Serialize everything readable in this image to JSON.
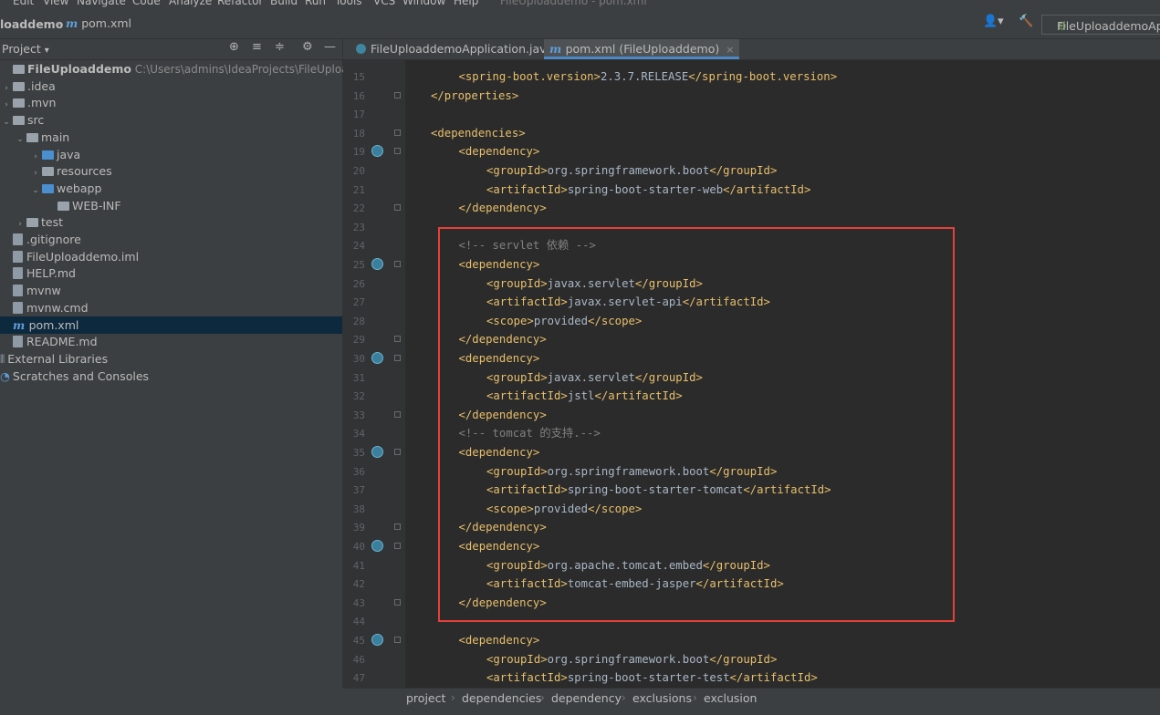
{
  "menubar": {
    "items": [
      "Edit",
      "View",
      "Navigate",
      "Code",
      "Analyze",
      "Refactor",
      "Build",
      "Run",
      "Tools",
      "VCS",
      "Window",
      "Help"
    ],
    "window_title": "FileUploaddemo - pom.xml"
  },
  "navbar": {
    "project": "loaddemo",
    "file_icon": "m",
    "file": "pom.xml",
    "run_config": "FileUploaddemoAp"
  },
  "sidebar": {
    "title": "Project",
    "title_arrow": "▾",
    "tools": [
      "⊕",
      "≡",
      "≑",
      "⚙",
      "—"
    ],
    "tree": [
      {
        "label": "FileUploaddemo",
        "path": "C:\\Users\\admins\\IdeaProjects\\FileUploaddemo",
        "indent": 0,
        "arrow": "",
        "icon": "folder",
        "bold": true
      },
      {
        "label": ".idea",
        "indent": 0,
        "arrow": "›",
        "icon": "folder"
      },
      {
        "label": ".mvn",
        "indent": 0,
        "arrow": "›",
        "icon": "folder"
      },
      {
        "label": "src",
        "indent": 0,
        "arrow": "⌄",
        "icon": "folder"
      },
      {
        "label": "main",
        "indent": 1,
        "arrow": "⌄",
        "icon": "folder"
      },
      {
        "label": "java",
        "indent": 2,
        "arrow": "›",
        "icon": "folder-blue"
      },
      {
        "label": "resources",
        "indent": 2,
        "arrow": "›",
        "icon": "folder"
      },
      {
        "label": "webapp",
        "indent": 2,
        "arrow": "⌄",
        "icon": "folder-blue"
      },
      {
        "label": "WEB-INF",
        "indent": 3,
        "arrow": "",
        "icon": "folder"
      },
      {
        "label": "test",
        "indent": 1,
        "arrow": "›",
        "icon": "folder"
      },
      {
        "label": ".gitignore",
        "indent": 0,
        "arrow": "",
        "icon": "file"
      },
      {
        "label": "FileUploaddemo.iml",
        "indent": 0,
        "arrow": "",
        "icon": "file"
      },
      {
        "label": "HELP.md",
        "indent": 0,
        "arrow": "",
        "icon": "file"
      },
      {
        "label": "mvnw",
        "indent": 0,
        "arrow": "",
        "icon": "file"
      },
      {
        "label": "mvnw.cmd",
        "indent": 0,
        "arrow": "",
        "icon": "file"
      },
      {
        "label": "pom.xml",
        "indent": 0,
        "arrow": "",
        "icon": "maven",
        "selected": true
      },
      {
        "label": "README.md",
        "indent": 0,
        "arrow": "",
        "icon": "file"
      },
      {
        "label": "External Libraries",
        "indent": -1,
        "arrow": "",
        "icon": "library"
      },
      {
        "label": "Scratches and Consoles",
        "indent": -1,
        "arrow": "",
        "icon": "scratch"
      }
    ]
  },
  "tabs": [
    {
      "label": "FileUploaddemoApplication.java",
      "icon": "java-class-icon",
      "active": false
    },
    {
      "label": "pom.xml (FileUploaddemo)",
      "icon": "maven-icon",
      "active": true
    }
  ],
  "editor": {
    "lines": [
      {
        "n": "15",
        "indent": 1,
        "parts": [
          [
            "tag",
            "<spring-boot.version>"
          ],
          [
            "text",
            "2.3.7.RELEASE"
          ],
          [
            "tag",
            "</spring-boot.version>"
          ]
        ]
      },
      {
        "n": "16",
        "indent": 0,
        "parts": [
          [
            "tag",
            "</properties>"
          ]
        ],
        "fold": true
      },
      {
        "n": "17",
        "indent": 0,
        "parts": []
      },
      {
        "n": "18",
        "indent": 0,
        "parts": [
          [
            "tag",
            "<dependencies>"
          ]
        ],
        "fold": true
      },
      {
        "n": "19",
        "indent": 1,
        "parts": [
          [
            "tag",
            "<dependency>"
          ]
        ],
        "icon": true,
        "fold": true
      },
      {
        "n": "20",
        "indent": 2,
        "parts": [
          [
            "tag",
            "<groupId>"
          ],
          [
            "text",
            "org.springframework.boot"
          ],
          [
            "tag",
            "</groupId>"
          ]
        ]
      },
      {
        "n": "21",
        "indent": 2,
        "parts": [
          [
            "tag",
            "<artifactId>"
          ],
          [
            "text",
            "spring-boot-starter-web"
          ],
          [
            "tag",
            "</artifactId>"
          ]
        ]
      },
      {
        "n": "22",
        "indent": 1,
        "parts": [
          [
            "tag",
            "</dependency>"
          ]
        ],
        "fold": true
      },
      {
        "n": "23",
        "indent": 0,
        "parts": []
      },
      {
        "n": "24",
        "indent": 1,
        "parts": [
          [
            "comment",
            "<!-- servlet 依赖 -->"
          ]
        ]
      },
      {
        "n": "25",
        "indent": 1,
        "parts": [
          [
            "tag",
            "<dependency>"
          ]
        ],
        "icon": true,
        "fold": true
      },
      {
        "n": "26",
        "indent": 2,
        "parts": [
          [
            "tag",
            "<groupId>"
          ],
          [
            "text",
            "javax.servlet"
          ],
          [
            "tag",
            "</groupId>"
          ]
        ]
      },
      {
        "n": "27",
        "indent": 2,
        "parts": [
          [
            "tag",
            "<artifactId>"
          ],
          [
            "text",
            "javax.servlet-api"
          ],
          [
            "tag",
            "</artifactId>"
          ]
        ]
      },
      {
        "n": "28",
        "indent": 2,
        "parts": [
          [
            "tag",
            "<scope>"
          ],
          [
            "text",
            "provided"
          ],
          [
            "tag",
            "</scope>"
          ]
        ]
      },
      {
        "n": "29",
        "indent": 1,
        "parts": [
          [
            "tag",
            "</dependency>"
          ]
        ],
        "fold": true
      },
      {
        "n": "30",
        "indent": 1,
        "parts": [
          [
            "tag",
            "<dependency>"
          ]
        ],
        "icon": true,
        "fold": true
      },
      {
        "n": "31",
        "indent": 2,
        "parts": [
          [
            "tag",
            "<groupId>"
          ],
          [
            "text",
            "javax.servlet"
          ],
          [
            "tag",
            "</groupId>"
          ]
        ]
      },
      {
        "n": "32",
        "indent": 2,
        "parts": [
          [
            "tag",
            "<artifactId>"
          ],
          [
            "text",
            "jstl"
          ],
          [
            "tag",
            "</artifactId>"
          ]
        ]
      },
      {
        "n": "33",
        "indent": 1,
        "parts": [
          [
            "tag",
            "</dependency>"
          ]
        ],
        "fold": true
      },
      {
        "n": "34",
        "indent": 1,
        "parts": [
          [
            "comment",
            "<!-- tomcat 的支持.-->"
          ]
        ]
      },
      {
        "n": "35",
        "indent": 1,
        "parts": [
          [
            "tag",
            "<dependency>"
          ]
        ],
        "icon": true,
        "fold": true
      },
      {
        "n": "36",
        "indent": 2,
        "parts": [
          [
            "tag",
            "<groupId>"
          ],
          [
            "text",
            "org.springframework.boot"
          ],
          [
            "tag",
            "</groupId>"
          ]
        ]
      },
      {
        "n": "37",
        "indent": 2,
        "parts": [
          [
            "tag",
            "<artifactId>"
          ],
          [
            "text",
            "spring-boot-starter-tomcat"
          ],
          [
            "tag",
            "</artifactId>"
          ]
        ]
      },
      {
        "n": "38",
        "indent": 2,
        "parts": [
          [
            "tag",
            "<scope>"
          ],
          [
            "text",
            "provided"
          ],
          [
            "tag",
            "</scope>"
          ]
        ]
      },
      {
        "n": "39",
        "indent": 1,
        "parts": [
          [
            "tag",
            "</dependency>"
          ]
        ],
        "fold": true
      },
      {
        "n": "40",
        "indent": 1,
        "parts": [
          [
            "tag",
            "<dependency>"
          ]
        ],
        "icon": true,
        "fold": true
      },
      {
        "n": "41",
        "indent": 2,
        "parts": [
          [
            "tag",
            "<groupId>"
          ],
          [
            "text",
            "org.apache.tomcat.embed"
          ],
          [
            "tag",
            "</groupId>"
          ]
        ]
      },
      {
        "n": "42",
        "indent": 2,
        "parts": [
          [
            "tag",
            "<artifactId>"
          ],
          [
            "text",
            "tomcat-embed-jasper"
          ],
          [
            "tag",
            "</artifactId>"
          ]
        ]
      },
      {
        "n": "43",
        "indent": 1,
        "parts": [
          [
            "tag",
            "</dependency>"
          ]
        ],
        "fold": true
      },
      {
        "n": "44",
        "indent": 0,
        "parts": []
      },
      {
        "n": "45",
        "indent": 1,
        "parts": [
          [
            "tag",
            "<dependency>"
          ]
        ],
        "icon": true,
        "fold": true
      },
      {
        "n": "46",
        "indent": 2,
        "parts": [
          [
            "tag",
            "<groupId>"
          ],
          [
            "text",
            "org.springframework.boot"
          ],
          [
            "tag",
            "</groupId>"
          ]
        ]
      },
      {
        "n": "47",
        "indent": 2,
        "parts": [
          [
            "tag",
            "<artifactId>"
          ],
          [
            "text",
            "spring-boot-starter-test"
          ],
          [
            "tag",
            "</artifactId>"
          ]
        ]
      }
    ]
  },
  "breadcrumbs": [
    "project",
    "dependencies",
    "dependency",
    "exclusions",
    "exclusion"
  ],
  "colors": {
    "tag": "#e8bf6a",
    "text": "#a9b7c6",
    "comment": "#808080",
    "highlight_box": "#e5403a",
    "selection": "#0d293e"
  }
}
